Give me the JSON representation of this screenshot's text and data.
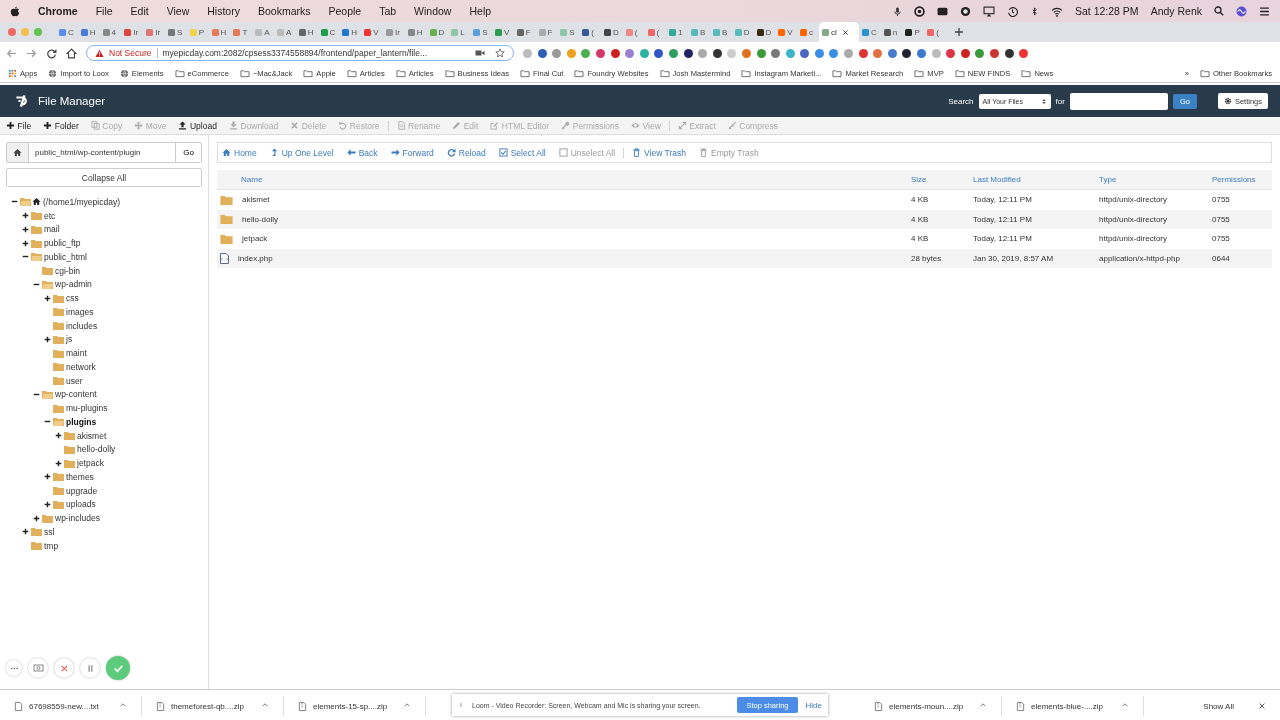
{
  "menubar": {
    "app": "Chrome",
    "menus": [
      "File",
      "Edit",
      "View",
      "History",
      "Bookmarks",
      "People",
      "Tab",
      "Window",
      "Help"
    ],
    "clock": "Sat 12:28 PM",
    "user": "Andy Renk"
  },
  "tabs": [
    {
      "title": "C",
      "selected": false
    },
    {
      "title": "H",
      "selected": false
    },
    {
      "title": "4",
      "selected": false
    },
    {
      "title": "Ir",
      "selected": false
    },
    {
      "title": "Ir",
      "selected": false
    },
    {
      "title": "S",
      "selected": false
    },
    {
      "title": "P",
      "selected": false
    },
    {
      "title": "H",
      "selected": false
    },
    {
      "title": "T",
      "selected": false
    },
    {
      "title": "A",
      "selected": false
    },
    {
      "title": "A",
      "selected": false
    },
    {
      "title": "H",
      "selected": false
    },
    {
      "title": "C",
      "selected": false
    },
    {
      "title": "H",
      "selected": false
    },
    {
      "title": "V",
      "selected": false
    },
    {
      "title": "Ir",
      "selected": false
    },
    {
      "title": "H",
      "selected": false
    },
    {
      "title": "D",
      "selected": false
    },
    {
      "title": "L",
      "selected": false
    },
    {
      "title": "S",
      "selected": false
    },
    {
      "title": "V",
      "selected": false
    },
    {
      "title": "F",
      "selected": false
    },
    {
      "title": "F",
      "selected": false
    },
    {
      "title": "S",
      "selected": false
    },
    {
      "title": "(",
      "selected": false
    },
    {
      "title": "D",
      "selected": false
    },
    {
      "title": "(",
      "selected": false
    },
    {
      "title": "(",
      "selected": false
    },
    {
      "title": "1",
      "selected": false
    },
    {
      "title": "B",
      "selected": false
    },
    {
      "title": "B",
      "selected": false
    },
    {
      "title": "D",
      "selected": false
    },
    {
      "title": "D",
      "selected": false
    },
    {
      "title": "V",
      "selected": false
    },
    {
      "title": "c",
      "selected": false
    },
    {
      "title": "cl",
      "selected": true
    },
    {
      "title": "C",
      "selected": false
    },
    {
      "title": "n",
      "selected": false
    },
    {
      "title": "P",
      "selected": false
    },
    {
      "title": "(",
      "selected": false
    }
  ],
  "address_bar": {
    "security": "Not Secure",
    "url": "myepicday.com:2082/cpsess3374558894/frontend/paper_lantern/file..."
  },
  "bookmarks": [
    {
      "label": "Apps",
      "kind": "apps"
    },
    {
      "label": "Import to Loox",
      "kind": "site"
    },
    {
      "label": "Elements",
      "kind": "site"
    },
    {
      "label": "eCommerce",
      "kind": "folder"
    },
    {
      "label": "~Mac&Jack",
      "kind": "folder"
    },
    {
      "label": "Apple",
      "kind": "folder"
    },
    {
      "label": "Articles",
      "kind": "folder"
    },
    {
      "label": "Articles",
      "kind": "folder"
    },
    {
      "label": "Business Ideas",
      "kind": "folder"
    },
    {
      "label": "Final Cut",
      "kind": "folder"
    },
    {
      "label": "Foundry Websites",
      "kind": "folder"
    },
    {
      "label": "Josh Mastermind",
      "kind": "folder"
    },
    {
      "label": "Instagram Marketi...",
      "kind": "folder"
    },
    {
      "label": "Market Research",
      "kind": "folder"
    },
    {
      "label": "MVP",
      "kind": "folder"
    },
    {
      "label": "NEW FINDS",
      "kind": "folder"
    },
    {
      "label": "News",
      "kind": "folder"
    }
  ],
  "bookmarks_overflow": "»",
  "other_bookmarks": "Other Bookmarks",
  "app": {
    "title": "File Manager",
    "search_label": "Search",
    "search_scope": "All Your Files",
    "for_label": "for",
    "go": "Go",
    "settings": "Settings"
  },
  "toolbar_groups": [
    {
      "items": [
        {
          "label": "File",
          "disabled": false
        },
        {
          "label": "Folder",
          "disabled": false
        },
        {
          "label": "Copy",
          "disabled": true
        },
        {
          "label": "Move",
          "disabled": true
        },
        {
          "label": "Upload",
          "disabled": false
        },
        {
          "label": "Download",
          "disabled": true
        },
        {
          "label": "Delete",
          "disabled": true
        },
        {
          "label": "Restore",
          "disabled": true
        }
      ]
    },
    {
      "items": [
        {
          "label": "Rename",
          "disabled": true
        },
        {
          "label": "Edit",
          "disabled": true
        },
        {
          "label": "HTML Editor",
          "disabled": true
        },
        {
          "label": "Permissions",
          "disabled": true
        },
        {
          "label": "View",
          "disabled": true
        }
      ]
    },
    {
      "items": [
        {
          "label": "Extract",
          "disabled": true
        },
        {
          "label": "Compress",
          "disabled": true
        }
      ]
    }
  ],
  "path_bar": {
    "value": "public_html/wp-content/plugin",
    "go": "Go",
    "collapse": "Collapse All"
  },
  "tree": [
    {
      "label": "(/home1/myepicday)",
      "kind": "home",
      "expanded": true,
      "selected": false,
      "children": [
        {
          "label": "etc",
          "expanded": false,
          "selected": false
        },
        {
          "label": "mail",
          "expanded": false,
          "selected": false
        },
        {
          "label": "public_ftp",
          "expanded": false,
          "selected": false
        },
        {
          "label": "public_html",
          "expanded": true,
          "selected": false,
          "children": [
            {
              "label": "cgi-bin",
              "selected": false
            },
            {
              "label": "wp-admin",
              "expanded": true,
              "selected": false,
              "children": [
                {
                  "label": "css",
                  "expanded": false,
                  "selected": false
                },
                {
                  "label": "images",
                  "selected": false
                },
                {
                  "label": "includes",
                  "selected": false
                },
                {
                  "label": "js",
                  "expanded": false,
                  "selected": false
                },
                {
                  "label": "maint",
                  "selected": false
                },
                {
                  "label": "network",
                  "selected": false
                },
                {
                  "label": "user",
                  "selected": false
                }
              ]
            },
            {
              "label": "wp-content",
              "expanded": true,
              "selected": false,
              "children": [
                {
                  "label": "mu-plugins",
                  "selected": false
                },
                {
                  "label": "plugins",
                  "expanded": true,
                  "selected": true,
                  "children": [
                    {
                      "label": "akismet",
                      "expanded": false,
                      "selected": false
                    },
                    {
                      "label": "hello-dolly",
                      "selected": false
                    },
                    {
                      "label": "jetpack",
                      "expanded": false,
                      "selected": false
                    }
                  ]
                },
                {
                  "label": "themes",
                  "expanded": false,
                  "selected": false
                },
                {
                  "label": "upgrade",
                  "selected": false
                },
                {
                  "label": "uploads",
                  "expanded": false,
                  "selected": false
                }
              ]
            },
            {
              "label": "wp-includes",
              "expanded": false,
              "selected": false
            }
          ]
        },
        {
          "label": "ssl",
          "expanded": false,
          "selected": false
        },
        {
          "label": "tmp",
          "selected": false
        }
      ]
    }
  ],
  "nav_groups": [
    {
      "items": [
        {
          "label": "Home",
          "disabled": false
        },
        {
          "label": "Up One Level",
          "disabled": false
        },
        {
          "label": "Back",
          "disabled": false
        },
        {
          "label": "Forward",
          "disabled": false
        },
        {
          "label": "Reload",
          "disabled": false
        },
        {
          "label": "Select All",
          "disabled": false
        },
        {
          "label": "Unselect All",
          "disabled": true
        }
      ]
    },
    {
      "items": [
        {
          "label": "View Trash",
          "disabled": false
        },
        {
          "label": "Empty Trash",
          "disabled": true
        }
      ]
    }
  ],
  "table": {
    "columns": [
      "Name",
      "Size",
      "Last Modified",
      "Type",
      "Permissions"
    ],
    "rows": [
      {
        "kind": "folder",
        "cells": [
          "akismet",
          "4 KB",
          "Today, 12:11 PM",
          "httpd/unix-directory",
          "0755"
        ]
      },
      {
        "kind": "folder",
        "cells": [
          "hello-dolly",
          "4 KB",
          "Today, 12:11 PM",
          "httpd/unix-directory",
          "0755"
        ]
      },
      {
        "kind": "folder",
        "cells": [
          "jetpack",
          "4 KB",
          "Today, 12:11 PM",
          "httpd/unix-directory",
          "0755"
        ]
      },
      {
        "kind": "file",
        "cells": [
          "index.php",
          "28 bytes",
          "Jan 30, 2019, 8:57 AM",
          "application/x-httpd-php",
          "0644"
        ]
      }
    ]
  },
  "downloads": [
    {
      "name": "67698559-new....txt"
    },
    {
      "name": "themeforest-qb....zip"
    },
    {
      "name": "elements-15-sp....zip"
    },
    {
      "name": "elements-moun....zip"
    },
    {
      "name": "elements-blue-....zip"
    }
  ],
  "show_all": "Show All",
  "loom_banner": {
    "message": "Loom - Video Recorder: Screen, Webcam and Mic is sharing your screen.",
    "stop": "Stop sharing",
    "hide": "Hide"
  }
}
